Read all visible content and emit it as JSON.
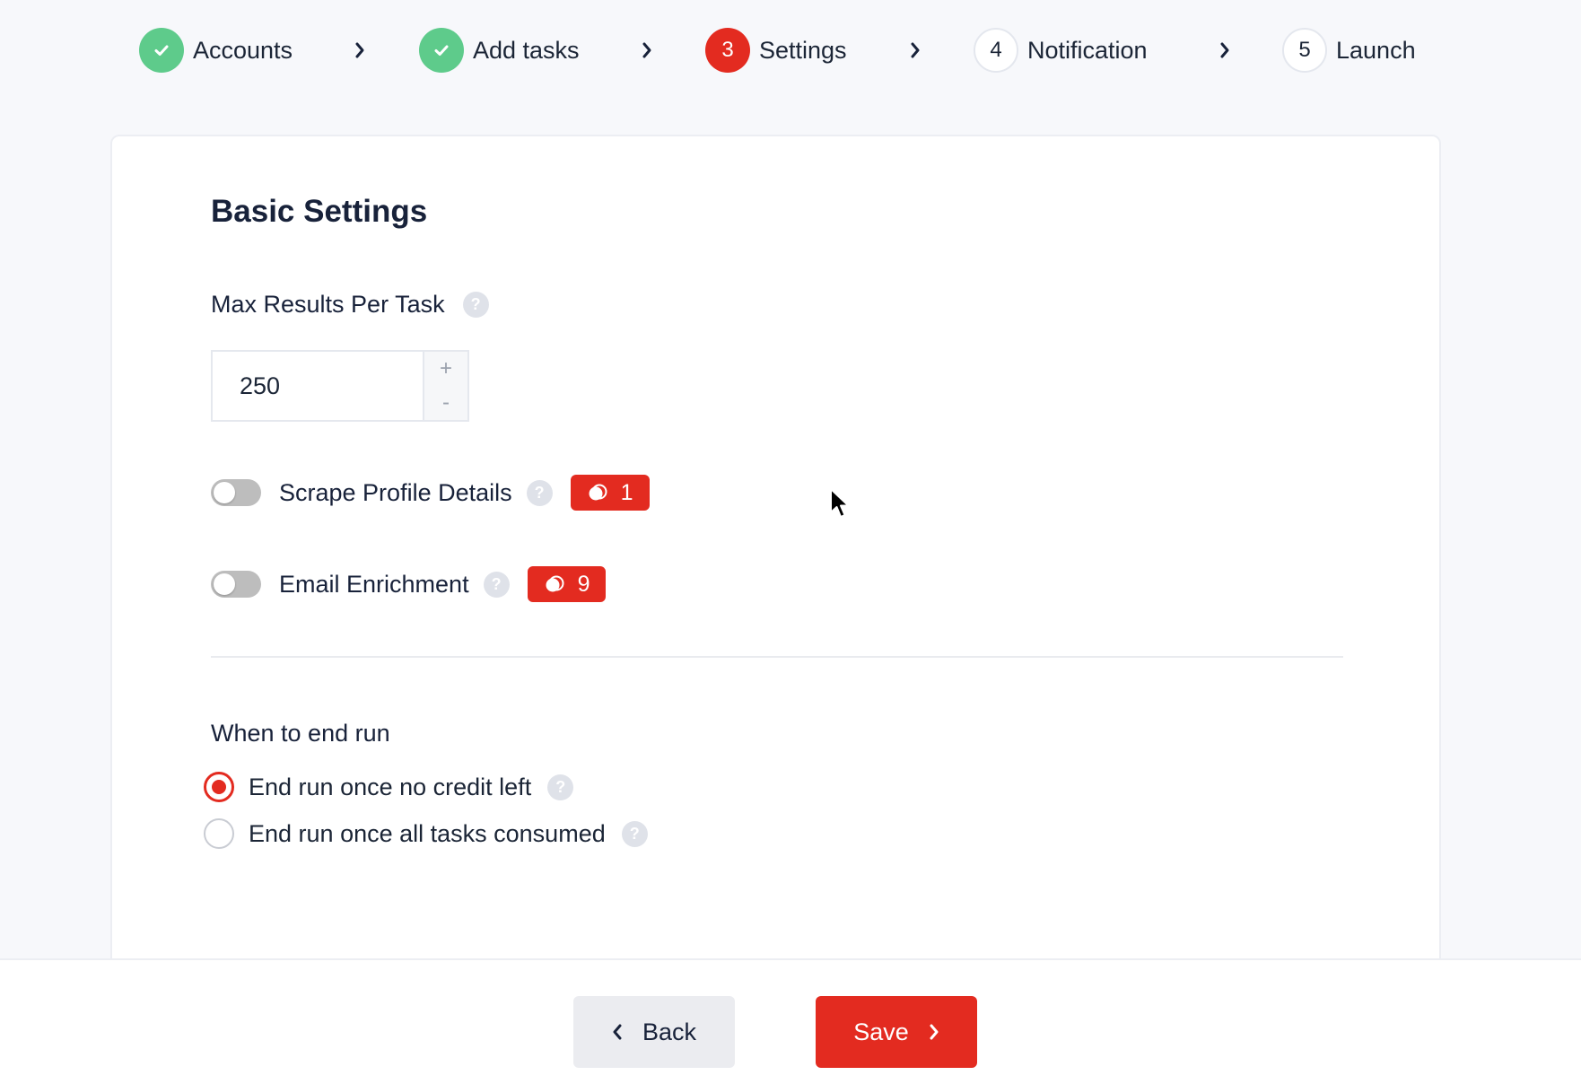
{
  "stepper": {
    "steps": [
      {
        "label": "Accounts",
        "number": "",
        "status": "done"
      },
      {
        "label": "Add tasks",
        "number": "",
        "status": "done"
      },
      {
        "label": "Settings",
        "number": "3",
        "status": "active"
      },
      {
        "label": "Notification",
        "number": "4",
        "status": "pending"
      },
      {
        "label": "Launch",
        "number": "5",
        "status": "pending"
      }
    ]
  },
  "basic_settings": {
    "title": "Basic Settings",
    "max_results": {
      "label": "Max Results Per Task",
      "help": "?",
      "value": "250",
      "increment": "+",
      "decrement": "-"
    },
    "scrape_profile": {
      "label": "Scrape Profile Details",
      "help": "?",
      "enabled": false,
      "credits": "1"
    },
    "email_enrichment": {
      "label": "Email Enrichment",
      "help": "?",
      "enabled": false,
      "credits": "9"
    }
  },
  "end_run": {
    "title": "When to end run",
    "options": [
      {
        "label": "End run once no credit left",
        "help": "?",
        "selected": true
      },
      {
        "label": "End run once all tasks consumed",
        "help": "?",
        "selected": false
      }
    ]
  },
  "footer": {
    "back_label": "Back",
    "save_label": "Save"
  },
  "colors": {
    "accent": "#e32b20",
    "done": "#5ecb8b",
    "toggle_off": "#bdbdbd"
  }
}
